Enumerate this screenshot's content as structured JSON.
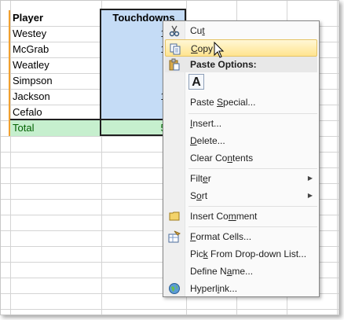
{
  "sheet": {
    "header": {
      "player": "Player",
      "touchdowns": "Touchdowns"
    },
    "rows": [
      {
        "player": "Westey",
        "touchdowns": "14"
      },
      {
        "player": "McGrab",
        "touchdowns": "10"
      },
      {
        "player": "Weatley",
        "touchdowns": "4"
      },
      {
        "player": "Simpson",
        "touchdowns": "5"
      },
      {
        "player": "Jackson",
        "touchdowns": "12"
      },
      {
        "player": "Cefalo",
        "touchdowns": "7"
      }
    ],
    "total": {
      "label": "Total",
      "value": "52"
    }
  },
  "menu": {
    "cut": {
      "pre": "Cu",
      "key": "t",
      "post": "",
      "icon": "scissors-icon"
    },
    "copy": {
      "pre": "",
      "key": "C",
      "post": "opy",
      "icon": "copy-icon"
    },
    "paste_options": {
      "label": "Paste Options:",
      "icon": "clipboard-icon",
      "paste_button": "A"
    },
    "paste_special": {
      "pre": "Paste ",
      "key": "S",
      "post": "pecial..."
    },
    "insert": {
      "pre": "",
      "key": "I",
      "post": "nsert..."
    },
    "delete": {
      "pre": "",
      "key": "D",
      "post": "elete..."
    },
    "clear_contents": {
      "pre": "Clear Co",
      "key": "n",
      "post": "tents"
    },
    "filter": {
      "pre": "Filt",
      "key": "e",
      "post": "r"
    },
    "sort": {
      "pre": "S",
      "key": "o",
      "post": "rt"
    },
    "insert_comment": {
      "pre": "Insert Co",
      "key": "m",
      "post": "ment",
      "icon": "comment-icon"
    },
    "format_cells": {
      "pre": "",
      "key": "F",
      "post": "ormat Cells...",
      "icon": "format-cells-icon"
    },
    "pick_dropdown": {
      "pre": "Pic",
      "key": "k",
      "post": " From Drop-down List..."
    },
    "define_name": {
      "pre": "Define N",
      "key": "a",
      "post": "me..."
    },
    "hyperlink": {
      "pre": "Hyperl",
      "key": "i",
      "post": "nk...",
      "icon": "globe-icon"
    }
  },
  "colors": {
    "selection": "#c5dcf6",
    "total_fill": "#c6efce",
    "total_text": "#006100",
    "highlight": "#ffe48f"
  }
}
